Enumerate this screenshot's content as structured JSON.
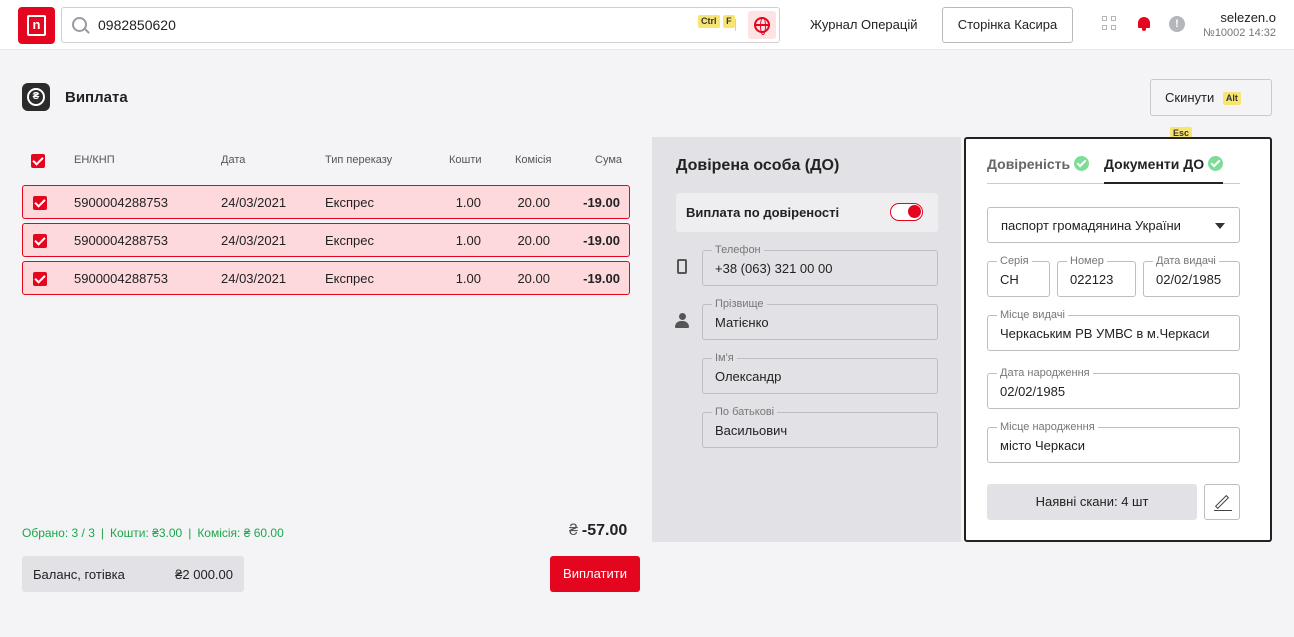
{
  "header": {
    "search_value": "0982850620",
    "search_hotkeys": [
      "Ctrl",
      "F"
    ],
    "nav_link": "Журнал Операцій",
    "cashier_button": "Сторінка Касира",
    "user_name": "selezen.o",
    "user_sub": "№10002 14:32",
    "alert_glyph": "!"
  },
  "page": {
    "title": "Виплата",
    "reset_label": "Скинути",
    "reset_hotkeys": [
      "Alt",
      "Esc"
    ]
  },
  "table": {
    "columns": [
      "ЕН/КНП",
      "Дата",
      "Тип переказу",
      "Кошти",
      "Комісія",
      "Сума"
    ],
    "rows": [
      {
        "id": "5900004288753",
        "date": "24/03/2021",
        "type": "Експрес",
        "funds": "1.00",
        "fee": "20.00",
        "sum": "-19.00"
      },
      {
        "id": "5900004288753",
        "date": "24/03/2021",
        "type": "Експрес",
        "funds": "1.00",
        "fee": "20.00",
        "sum": "-19.00"
      },
      {
        "id": "5900004288753",
        "date": "24/03/2021",
        "type": "Експрес",
        "funds": "1.00",
        "fee": "20.00",
        "sum": "-19.00"
      }
    ]
  },
  "summary": {
    "selected": "Обрано: 3 / 3",
    "funds": "Кошти: ₴3.00",
    "fee": "Комісія: ₴ 60.00",
    "divider": "|",
    "total_currency": "₴",
    "total": "-57.00"
  },
  "balance": {
    "label": "Баланс, готівка",
    "value": "₴2 000.00"
  },
  "pay_button": "Виплатити",
  "trustee": {
    "title": "Довірена особа (ДО)",
    "proxy_label": "Виплата по довіреності",
    "proxy_enabled": true,
    "phone_label": "Телефон",
    "phone_value": "+38 (063) 321 00 00",
    "surname_label": "Прізвище",
    "surname_value": "Матієнко",
    "name_label": "Ім'я",
    "name_value": "Олександр",
    "patronymic_label": "По батькові",
    "patronymic_value": "Васильович"
  },
  "docs": {
    "tab_proxy": "Довіреність",
    "tab_docs": "Документи ДО",
    "doc_type": "паспорт громадянина України",
    "series_label": "Серія",
    "series_value": "СН",
    "number_label": "Номер",
    "number_value": "022123",
    "issue_date_label": "Дата видачі",
    "issue_date_value": "02/02/1985",
    "issue_place_label": "Місце видачі",
    "issue_place_value": "Черкаським РВ УМВС в м.Черкаси",
    "birth_date_label": "Дата народження",
    "birth_date_value": "02/02/1985",
    "birth_place_label": "Місце народження",
    "birth_place_value": "місто Черкаси",
    "scans_label": "Наявні скани: 4 шт"
  },
  "colors": {
    "brand_red": "#e4051f",
    "row_highlight": "#fdd9dc",
    "success_green": "#1ca64c",
    "check_green": "#7ddc98"
  }
}
